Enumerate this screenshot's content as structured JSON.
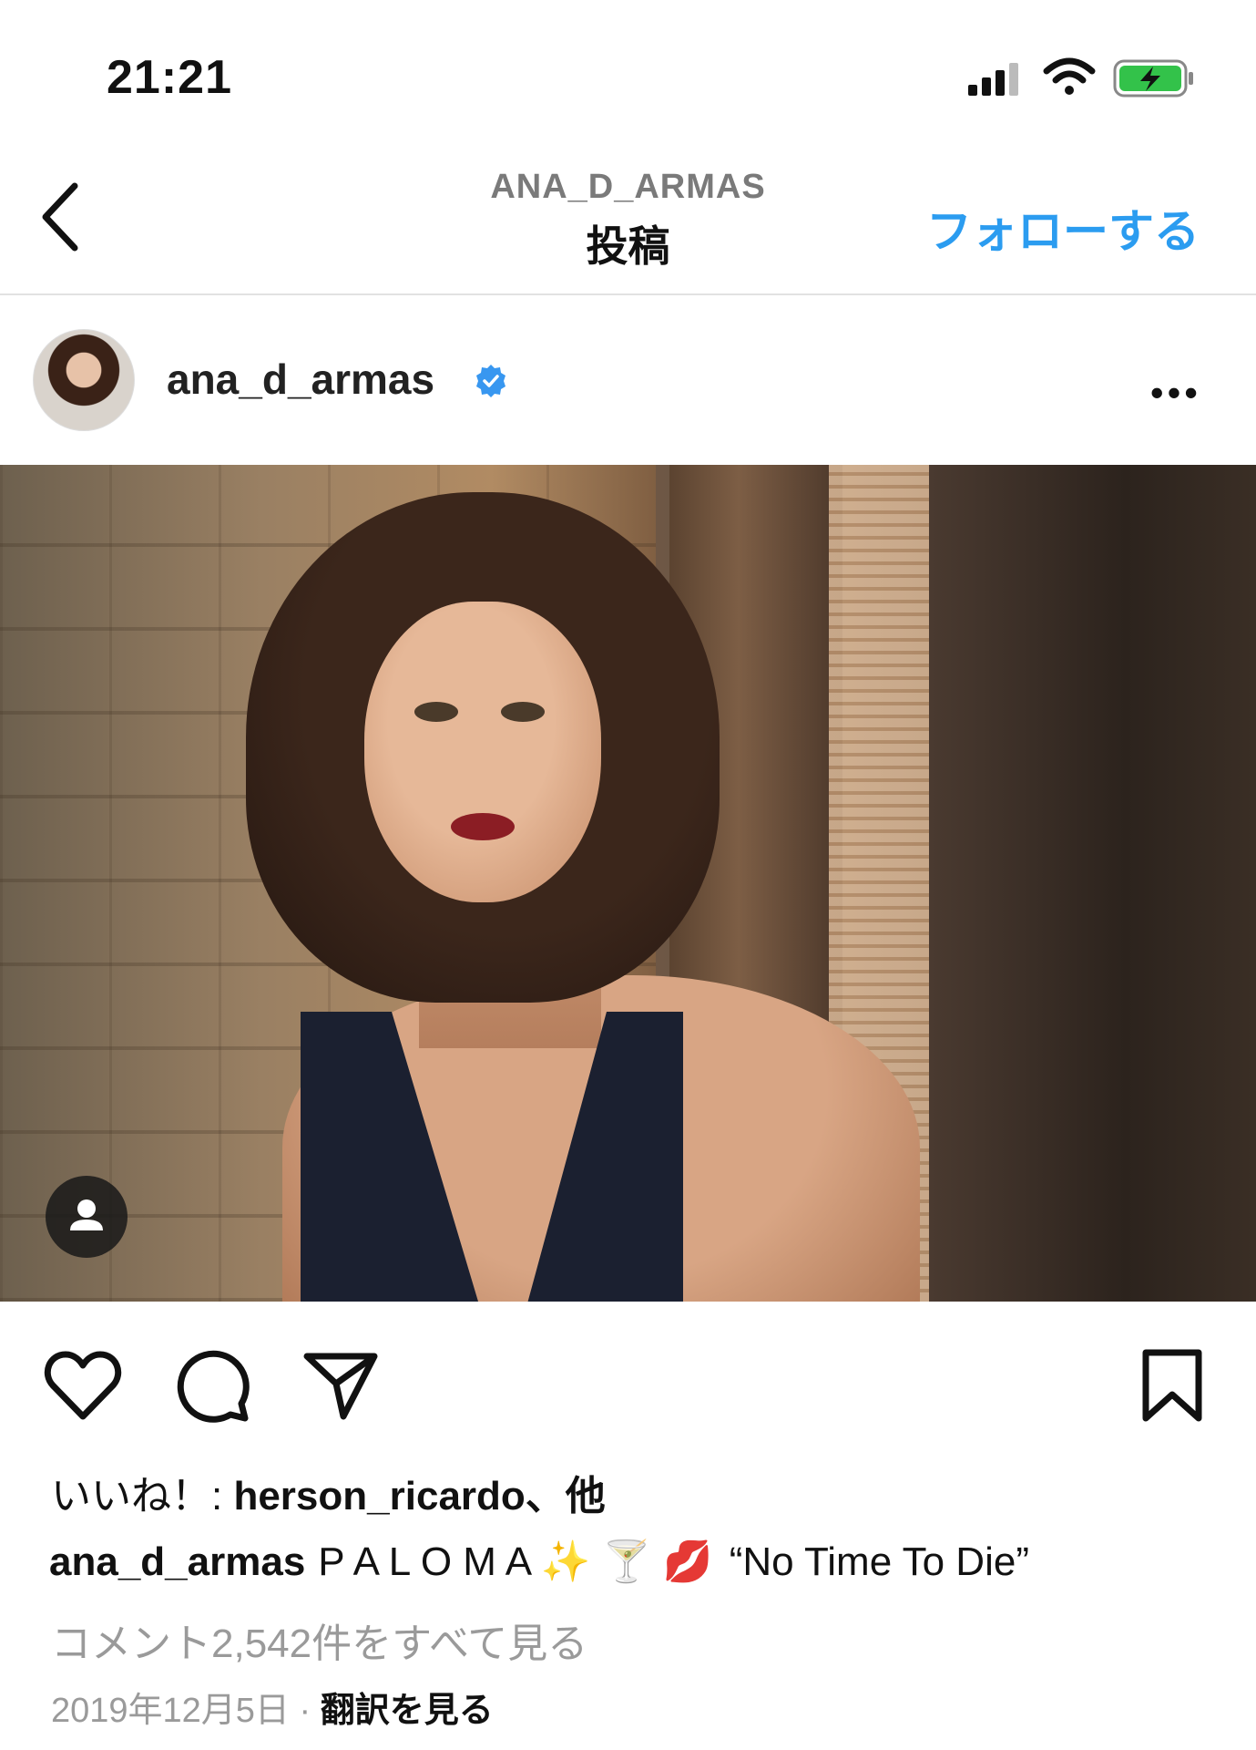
{
  "status_bar": {
    "time": "21:21",
    "battery_color": "#33c24a"
  },
  "nav": {
    "account": "ANA_D_ARMAS",
    "title": "投稿",
    "follow_label": "フォローする",
    "accent": "#2b9cf0"
  },
  "post": {
    "username": "ana_d_armas",
    "verified": true,
    "more_label": "•••"
  },
  "likes": {
    "prefix": "いいね！: ",
    "user": "herson_ricardo",
    "suffix": "、他"
  },
  "caption": {
    "user": "ana_d_armas",
    "text": "P A L O M A ✨ 🍸 💋",
    "quote": "“No Time To Die”"
  },
  "comments_link": "コメント2,542件をすべて見る",
  "meta": {
    "date": "2019年12月5日",
    "separator": " · ",
    "translate": "翻訳を見る"
  }
}
